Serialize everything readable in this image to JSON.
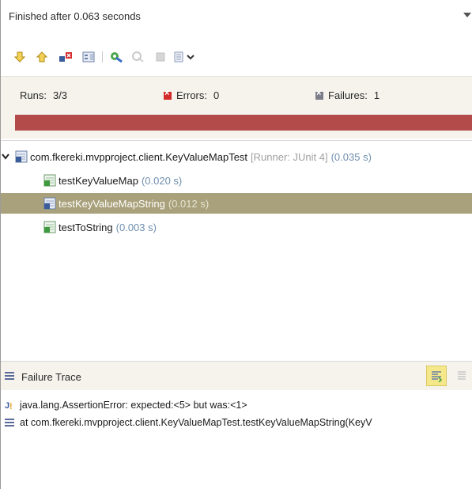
{
  "status": {
    "text": "Finished after 0.063 seconds"
  },
  "toolbar": {
    "items": [
      "next-failure-icon",
      "previous-failure-icon",
      "show-failures-only-icon",
      "scroll-lock-icon",
      "rerun-test-icon",
      "rerun-failed-first-icon",
      "stop-icon",
      "test-run-history-icon"
    ]
  },
  "counters": {
    "runs_label": "Runs:",
    "runs_value": "3/3",
    "errors_label": "Errors:",
    "errors_value": "0",
    "failures_label": "Failures:",
    "failures_value": "1"
  },
  "progress": {
    "fraction": 1.0,
    "color": "#b34b4b"
  },
  "tree": {
    "root": {
      "name": "com.fkereki.mvpproject.client.KeyValueMapTest",
      "runner": "[Runner: JUnit 4]",
      "time": "(0.035 s)"
    },
    "children": [
      {
        "name": "testKeyValueMap",
        "time": "(0.020 s)",
        "status": "pass"
      },
      {
        "name": "testKeyValueMapString",
        "time": "(0.012 s)",
        "status": "fail"
      },
      {
        "name": "testToString",
        "time": "(0.003 s)",
        "status": "pass"
      }
    ]
  },
  "trace": {
    "title": "Failure Trace",
    "lines": [
      "java.lang.AssertionError: expected:<5> but was:<1>",
      "at com.fkereki.mvpproject.client.KeyValueMapTest.testKeyValueMapString(KeyV"
    ]
  },
  "colors": {
    "panel_bg": "#f5f3ec",
    "selection": "#a9a17b",
    "time": "#6f8fb0"
  }
}
